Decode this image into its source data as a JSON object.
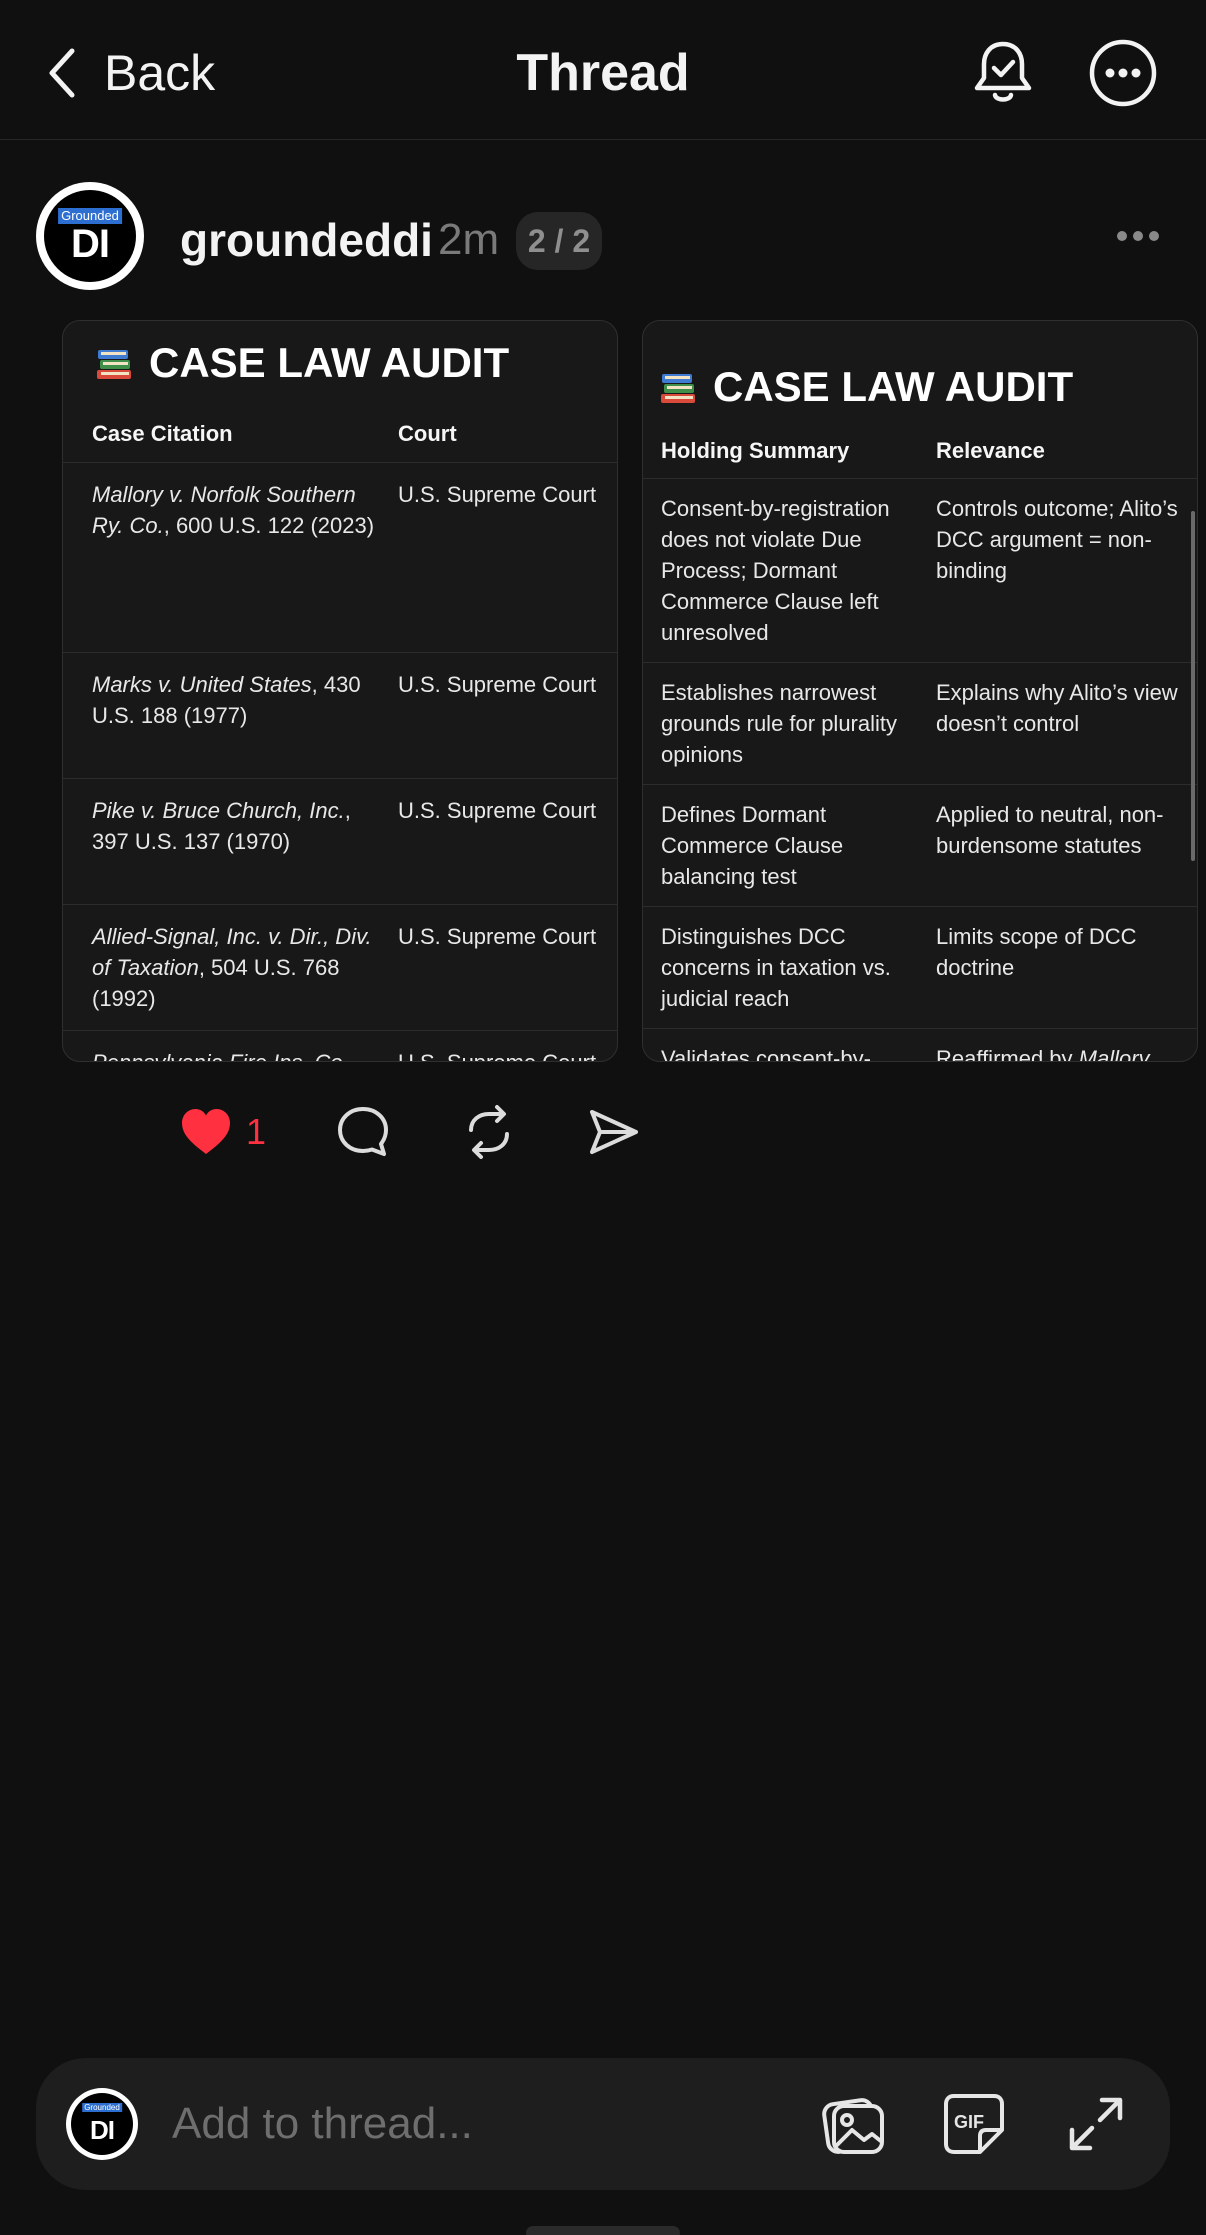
{
  "header": {
    "back_label": "Back",
    "title": "Thread"
  },
  "post": {
    "avatar_label": "Grounded",
    "avatar_initials": "DI",
    "username": "groundeddi",
    "timestamp": "2m",
    "pager": "2 / 2",
    "card1": {
      "emoji_icon": "books-icon",
      "title": "CASE LAW AUDIT",
      "columns": [
        "Case Citation",
        "Court"
      ],
      "rows": [
        {
          "case_name": "Mallory v. Norfolk Southern Ry. Co.",
          "reporter": ", 600 U.S. 122 (2023)",
          "court": "U.S. Supreme Court"
        },
        {
          "case_name": "Marks v. United States",
          "reporter": ", 430 U.S. 188 (1977)",
          "court": "U.S. Supreme Court"
        },
        {
          "case_name": "Pike v. Bruce Church, Inc.",
          "reporter": ", 397 U.S. 137 (1970)",
          "court": "U.S. Supreme Court"
        },
        {
          "case_name": "Allied-Signal, Inc. v. Dir., Div. of Taxation",
          "reporter": ", 504 U.S. 768 (1992)",
          "court": "U.S. Supreme Court"
        },
        {
          "case_name": "Pennsylvania Fire Ins. Co.",
          "reporter": "",
          "court": "U.S. Supreme Court"
        }
      ]
    },
    "card2": {
      "emoji_icon": "books-icon",
      "title": "CASE LAW AUDIT",
      "columns": [
        "Holding Summary",
        "Relevance"
      ],
      "rows": [
        {
          "holding": "Consent-by-registration does not violate Due Process; Dormant Commerce Clause left unresolved",
          "relevance": "Controls outcome; Alito’s DCC argument = non-binding"
        },
        {
          "holding": "Establishes narrowest grounds rule for plurality opinions",
          "relevance": "Explains why Alito’s view doesn’t control"
        },
        {
          "holding": "Defines Dormant Commerce Clause balancing test",
          "relevance": "Applied to neutral, non-burdensome statutes"
        },
        {
          "holding": "Distinguishes DCC concerns in taxation vs. judicial reach",
          "relevance": "Limits scope of DCC doctrine"
        },
        {
          "holding": "Validates consent-by-",
          "relevance_prefix": "Reaffirmed by ",
          "relevance_italic": "Mallory"
        }
      ]
    },
    "actions": {
      "like_count": "1",
      "like_color": "#ff3040"
    }
  },
  "composer": {
    "placeholder": "Add to thread...",
    "gif_label": "GIF"
  },
  "icons": {
    "back": "chevron-left-icon",
    "bell": "bell-check-icon",
    "more": "more-circle-icon",
    "like": "heart-icon",
    "comment": "comment-icon",
    "repost": "repost-icon",
    "share": "send-icon",
    "image": "image-icon",
    "gif": "gif-icon",
    "expand": "expand-icon"
  }
}
